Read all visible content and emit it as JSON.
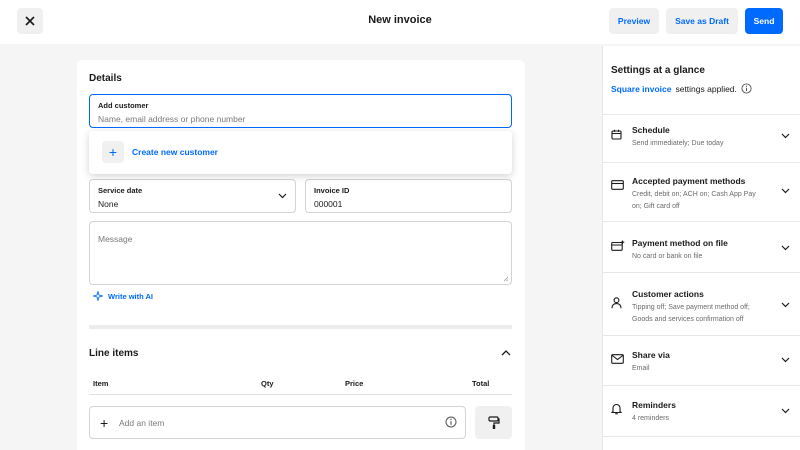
{
  "header": {
    "title": "New invoice",
    "preview_label": "Preview",
    "draft_label": "Save as Draft",
    "send_label": "Send"
  },
  "details": {
    "title": "Details",
    "customer": {
      "label": "Add customer",
      "placeholder": "Name, email address or phone number"
    },
    "create_customer": "Create new customer",
    "service_date": {
      "label": "Service date",
      "value": "None"
    },
    "invoice_id": {
      "label": "Invoice ID",
      "value": "000001"
    },
    "message_placeholder": "Message",
    "write_ai": "Write with AI"
  },
  "line_items": {
    "title": "Line items",
    "columns": [
      "Item",
      "Qty",
      "Price",
      "Total"
    ],
    "add_item_placeholder": "Add an item"
  },
  "settings": {
    "title": "Settings at a glance",
    "link": "Square invoice",
    "suffix": "settings applied.",
    "items": [
      {
        "icon": "calendar-icon",
        "title": "Schedule",
        "desc": "Send immediately; Due today"
      },
      {
        "icon": "card-icon",
        "title": "Accepted payment methods",
        "desc": "Credit, debit on; ACH on; Cash App Pay on; Gift card off"
      },
      {
        "icon": "card-plus-icon",
        "title": "Payment method on file",
        "desc": "No card or bank on file"
      },
      {
        "icon": "person-icon",
        "title": "Customer actions",
        "desc": "Tipping off; Save payment method off; Goods and services confirmation off"
      },
      {
        "icon": "envelope-icon",
        "title": "Share via",
        "desc": "Email"
      },
      {
        "icon": "bell-icon",
        "title": "Reminders",
        "desc": "4 reminders"
      }
    ]
  },
  "colors": {
    "accent": "#006aff",
    "background": "#f5f5f5"
  }
}
